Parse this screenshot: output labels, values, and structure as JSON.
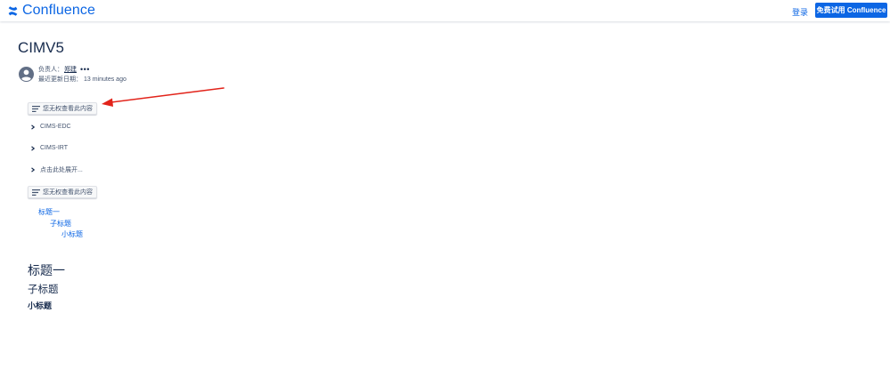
{
  "header": {
    "logo_text": "Confluence",
    "login_label": "登录",
    "trial_button_label": "免费试用 Confluence"
  },
  "page": {
    "title": "CIMV5",
    "byline": {
      "owner_label": "负责人：",
      "owner_name": "郑建",
      "updated_label": "最近更新日期：",
      "updated_value": "13 minutes ago"
    }
  },
  "content": {
    "restricted_1": "您无权查看此内容",
    "expand_items": [
      "CIMS-EDC",
      "CIMS-IRT",
      "点击此处展开..."
    ],
    "restricted_2": "您无权查看此内容",
    "toc": [
      "标题一",
      "子标题",
      "小标题"
    ],
    "headings": {
      "h1": "标题一",
      "h2": "子标题",
      "h3": "小标题"
    }
  },
  "colors": {
    "brand_blue": "#0c66e4",
    "text": "#172b4d",
    "subtle_text": "#44546f",
    "annotation_arrow": "#e2231a"
  },
  "icons": {
    "logo": "confluence-logo-icon",
    "avatar": "user-avatar-icon",
    "more": "more-horizontal-icon",
    "restricted": "restricted-content-icon",
    "expand": "chevron-right-icon"
  }
}
